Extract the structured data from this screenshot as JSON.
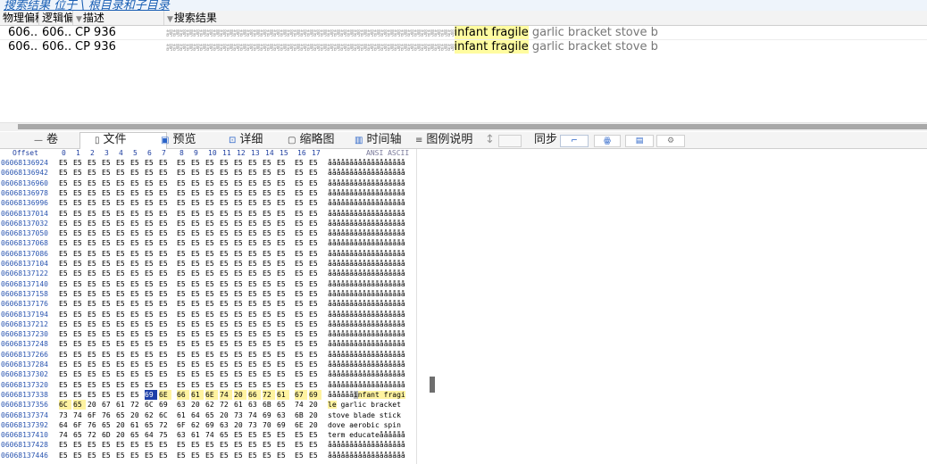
{
  "breadcrumb": "搜索结果 位于 \\ 根目录和子目录",
  "results": {
    "headers": [
      "物理偏移",
      "逻辑偏移",
      "描述",
      "搜索结果"
    ],
    "rows": [
      {
        "phys": "606...",
        "logical": "606...",
        "desc": "CP 936",
        "garbage": "諤諤諤諤諤諤諤諤諤諤諤諤諤諤諤諤諤諤諤諤諤諤諤諤諤諤諤諤諤諤諤諤諤諤諤諤諤諤諤諤諤諤諤",
        "hit": "infant fragile",
        "after": " garlic bracket stove b"
      },
      {
        "phys": "606...",
        "logical": "606...",
        "desc": "CP 936",
        "garbage": "諤諤諤諤諤諤諤諤諤諤諤諤諤諤諤諤諤諤諤諤諤諤諤諤諤諤諤諤諤諤諤諤諤諤諤諤諤諤諤諤諤諤諤",
        "hit": "infant fragile",
        "after": " garlic bracket stove b"
      }
    ]
  },
  "tabs": [
    {
      "icon": "—",
      "label": "卷"
    },
    {
      "icon": "▯",
      "label": "文件"
    },
    {
      "icon": "▣",
      "label": "预览"
    },
    {
      "icon": "⊡",
      "label": "详细"
    },
    {
      "icon": "▢",
      "label": "缩略图"
    },
    {
      "icon": "▥",
      "label": "时间轴"
    },
    {
      "icon": "≡",
      "label": "图例说明"
    }
  ],
  "sync_label": "同步",
  "hex": {
    "offset_header": "Offset",
    "columns": [
      "0",
      "1",
      "2",
      "3",
      "4",
      "5",
      "6",
      "7",
      "8",
      "9",
      "10",
      "11",
      "12",
      "13",
      "14",
      "15",
      "16",
      "17"
    ],
    "ansi_label": "ANSI ASCII",
    "rows": [
      {
        "offset": "06068136924",
        "bytes": [
          "E5",
          "E5",
          "E5",
          "E5",
          "E5",
          "E5",
          "E5",
          "E5",
          "E5",
          "E5",
          "E5",
          "E5",
          "E5",
          "E5",
          "E5",
          "E5",
          "E5",
          "E5"
        ],
        "ascii": "åååååååååååååååååå"
      },
      {
        "offset": "06068136942",
        "bytes": [
          "E5",
          "E5",
          "E5",
          "E5",
          "E5",
          "E5",
          "E5",
          "E5",
          "E5",
          "E5",
          "E5",
          "E5",
          "E5",
          "E5",
          "E5",
          "E5",
          "E5",
          "E5"
        ],
        "ascii": "åååååååååååååååååå"
      },
      {
        "offset": "06068136960",
        "bytes": [
          "E5",
          "E5",
          "E5",
          "E5",
          "E5",
          "E5",
          "E5",
          "E5",
          "E5",
          "E5",
          "E5",
          "E5",
          "E5",
          "E5",
          "E5",
          "E5",
          "E5",
          "E5"
        ],
        "ascii": "åååååååååååååååååå"
      },
      {
        "offset": "06068136978",
        "bytes": [
          "E5",
          "E5",
          "E5",
          "E5",
          "E5",
          "E5",
          "E5",
          "E5",
          "E5",
          "E5",
          "E5",
          "E5",
          "E5",
          "E5",
          "E5",
          "E5",
          "E5",
          "E5"
        ],
        "ascii": "åååååååååååååååååå"
      },
      {
        "offset": "06068136996",
        "bytes": [
          "E5",
          "E5",
          "E5",
          "E5",
          "E5",
          "E5",
          "E5",
          "E5",
          "E5",
          "E5",
          "E5",
          "E5",
          "E5",
          "E5",
          "E5",
          "E5",
          "E5",
          "E5"
        ],
        "ascii": "åååååååååååååååååå"
      },
      {
        "offset": "06068137014",
        "bytes": [
          "E5",
          "E5",
          "E5",
          "E5",
          "E5",
          "E5",
          "E5",
          "E5",
          "E5",
          "E5",
          "E5",
          "E5",
          "E5",
          "E5",
          "E5",
          "E5",
          "E5",
          "E5"
        ],
        "ascii": "åååååååååååååååååå"
      },
      {
        "offset": "06068137032",
        "bytes": [
          "E5",
          "E5",
          "E5",
          "E5",
          "E5",
          "E5",
          "E5",
          "E5",
          "E5",
          "E5",
          "E5",
          "E5",
          "E5",
          "E5",
          "E5",
          "E5",
          "E5",
          "E5"
        ],
        "ascii": "åååååååååååååååååå"
      },
      {
        "offset": "06068137050",
        "bytes": [
          "E5",
          "E5",
          "E5",
          "E5",
          "E5",
          "E5",
          "E5",
          "E5",
          "E5",
          "E5",
          "E5",
          "E5",
          "E5",
          "E5",
          "E5",
          "E5",
          "E5",
          "E5"
        ],
        "ascii": "åååååååååååååååååå"
      },
      {
        "offset": "06068137068",
        "bytes": [
          "E5",
          "E5",
          "E5",
          "E5",
          "E5",
          "E5",
          "E5",
          "E5",
          "E5",
          "E5",
          "E5",
          "E5",
          "E5",
          "E5",
          "E5",
          "E5",
          "E5",
          "E5"
        ],
        "ascii": "åååååååååååååååååå"
      },
      {
        "offset": "06068137086",
        "bytes": [
          "E5",
          "E5",
          "E5",
          "E5",
          "E5",
          "E5",
          "E5",
          "E5",
          "E5",
          "E5",
          "E5",
          "E5",
          "E5",
          "E5",
          "E5",
          "E5",
          "E5",
          "E5"
        ],
        "ascii": "åååååååååååååååååå"
      },
      {
        "offset": "06068137104",
        "bytes": [
          "E5",
          "E5",
          "E5",
          "E5",
          "E5",
          "E5",
          "E5",
          "E5",
          "E5",
          "E5",
          "E5",
          "E5",
          "E5",
          "E5",
          "E5",
          "E5",
          "E5",
          "E5"
        ],
        "ascii": "åååååååååååååååååå"
      },
      {
        "offset": "06068137122",
        "bytes": [
          "E5",
          "E5",
          "E5",
          "E5",
          "E5",
          "E5",
          "E5",
          "E5",
          "E5",
          "E5",
          "E5",
          "E5",
          "E5",
          "E5",
          "E5",
          "E5",
          "E5",
          "E5"
        ],
        "ascii": "åååååååååååååååååå"
      },
      {
        "offset": "06068137140",
        "bytes": [
          "E5",
          "E5",
          "E5",
          "E5",
          "E5",
          "E5",
          "E5",
          "E5",
          "E5",
          "E5",
          "E5",
          "E5",
          "E5",
          "E5",
          "E5",
          "E5",
          "E5",
          "E5"
        ],
        "ascii": "åååååååååååååååååå"
      },
      {
        "offset": "06068137158",
        "bytes": [
          "E5",
          "E5",
          "E5",
          "E5",
          "E5",
          "E5",
          "E5",
          "E5",
          "E5",
          "E5",
          "E5",
          "E5",
          "E5",
          "E5",
          "E5",
          "E5",
          "E5",
          "E5"
        ],
        "ascii": "åååååååååååååååååå"
      },
      {
        "offset": "06068137176",
        "bytes": [
          "E5",
          "E5",
          "E5",
          "E5",
          "E5",
          "E5",
          "E5",
          "E5",
          "E5",
          "E5",
          "E5",
          "E5",
          "E5",
          "E5",
          "E5",
          "E5",
          "E5",
          "E5"
        ],
        "ascii": "åååååååååååååååååå"
      },
      {
        "offset": "06068137194",
        "bytes": [
          "E5",
          "E5",
          "E5",
          "E5",
          "E5",
          "E5",
          "E5",
          "E5",
          "E5",
          "E5",
          "E5",
          "E5",
          "E5",
          "E5",
          "E5",
          "E5",
          "E5",
          "E5"
        ],
        "ascii": "åååååååååååååååååå"
      },
      {
        "offset": "06068137212",
        "bytes": [
          "E5",
          "E5",
          "E5",
          "E5",
          "E5",
          "E5",
          "E5",
          "E5",
          "E5",
          "E5",
          "E5",
          "E5",
          "E5",
          "E5",
          "E5",
          "E5",
          "E5",
          "E5"
        ],
        "ascii": "åååååååååååååååååå"
      },
      {
        "offset": "06068137230",
        "bytes": [
          "E5",
          "E5",
          "E5",
          "E5",
          "E5",
          "E5",
          "E5",
          "E5",
          "E5",
          "E5",
          "E5",
          "E5",
          "E5",
          "E5",
          "E5",
          "E5",
          "E5",
          "E5"
        ],
        "ascii": "åååååååååååååååååå"
      },
      {
        "offset": "06068137248",
        "bytes": [
          "E5",
          "E5",
          "E5",
          "E5",
          "E5",
          "E5",
          "E5",
          "E5",
          "E5",
          "E5",
          "E5",
          "E5",
          "E5",
          "E5",
          "E5",
          "E5",
          "E5",
          "E5"
        ],
        "ascii": "åååååååååååååååååå"
      },
      {
        "offset": "06068137266",
        "bytes": [
          "E5",
          "E5",
          "E5",
          "E5",
          "E5",
          "E5",
          "E5",
          "E5",
          "E5",
          "E5",
          "E5",
          "E5",
          "E5",
          "E5",
          "E5",
          "E5",
          "E5",
          "E5"
        ],
        "ascii": "åååååååååååååååååå"
      },
      {
        "offset": "06068137284",
        "bytes": [
          "E5",
          "E5",
          "E5",
          "E5",
          "E5",
          "E5",
          "E5",
          "E5",
          "E5",
          "E5",
          "E5",
          "E5",
          "E5",
          "E5",
          "E5",
          "E5",
          "E5",
          "E5"
        ],
        "ascii": "åååååååååååååååååå"
      },
      {
        "offset": "06068137302",
        "bytes": [
          "E5",
          "E5",
          "E5",
          "E5",
          "E5",
          "E5",
          "E5",
          "E5",
          "E5",
          "E5",
          "E5",
          "E5",
          "E5",
          "E5",
          "E5",
          "E5",
          "E5",
          "E5"
        ],
        "ascii": "åååååååååååååååååå"
      },
      {
        "offset": "06068137320",
        "bytes": [
          "E5",
          "E5",
          "E5",
          "E5",
          "E5",
          "E5",
          "E5",
          "E5",
          "E5",
          "E5",
          "E5",
          "E5",
          "E5",
          "E5",
          "E5",
          "E5",
          "E5",
          "E5"
        ],
        "ascii": "åååååååååååååååååå"
      },
      {
        "offset": "06068137338",
        "bytes": [
          "E5",
          "E5",
          "E5",
          "E5",
          "E5",
          "E5",
          "69",
          "6E",
          "66",
          "61",
          "6E",
          "74",
          "20",
          "66",
          "72",
          "61",
          "67",
          "69"
        ],
        "ascii_pre": "åååååå",
        "ascii_cur": "i",
        "ascii_hl": "nfant fragi",
        "sel_from": 6
      },
      {
        "offset": "06068137356",
        "bytes": [
          "6C",
          "65",
          "20",
          "67",
          "61",
          "72",
          "6C",
          "69",
          "63",
          "20",
          "62",
          "72",
          "61",
          "63",
          "6B",
          "65",
          "74",
          "20"
        ],
        "ascii_hl": "le",
        "ascii_post": " garlic bracket",
        "sel_to": 2
      },
      {
        "offset": "06068137374",
        "bytes": [
          "73",
          "74",
          "6F",
          "76",
          "65",
          "20",
          "62",
          "6C",
          "61",
          "64",
          "65",
          "20",
          "73",
          "74",
          "69",
          "63",
          "6B",
          "20"
        ],
        "ascii": "stove blade stick "
      },
      {
        "offset": "06068137392",
        "bytes": [
          "64",
          "6F",
          "76",
          "65",
          "20",
          "61",
          "65",
          "72",
          "6F",
          "62",
          "69",
          "63",
          "20",
          "73",
          "70",
          "69",
          "6E",
          "20"
        ],
        "ascii": "dove aerobic spin "
      },
      {
        "offset": "06068137410",
        "bytes": [
          "74",
          "65",
          "72",
          "6D",
          "20",
          "65",
          "64",
          "75",
          "63",
          "61",
          "74",
          "65",
          "E5",
          "E5",
          "E5",
          "E5",
          "E5",
          "E5"
        ],
        "ascii": "term educateåååååå"
      },
      {
        "offset": "06068137428",
        "bytes": [
          "E5",
          "E5",
          "E5",
          "E5",
          "E5",
          "E5",
          "E5",
          "E5",
          "E5",
          "E5",
          "E5",
          "E5",
          "E5",
          "E5",
          "E5",
          "E5",
          "E5",
          "E5"
        ],
        "ascii": "åååååååååååååååååå"
      },
      {
        "offset": "06068137446",
        "bytes": [
          "E5",
          "E5",
          "E5",
          "E5",
          "E5",
          "E5",
          "E5",
          "E5",
          "E5",
          "E5",
          "E5",
          "E5",
          "E5",
          "E5",
          "E5",
          "E5",
          "E5",
          "E5"
        ],
        "ascii": "åååååååååååååååååå"
      }
    ]
  }
}
